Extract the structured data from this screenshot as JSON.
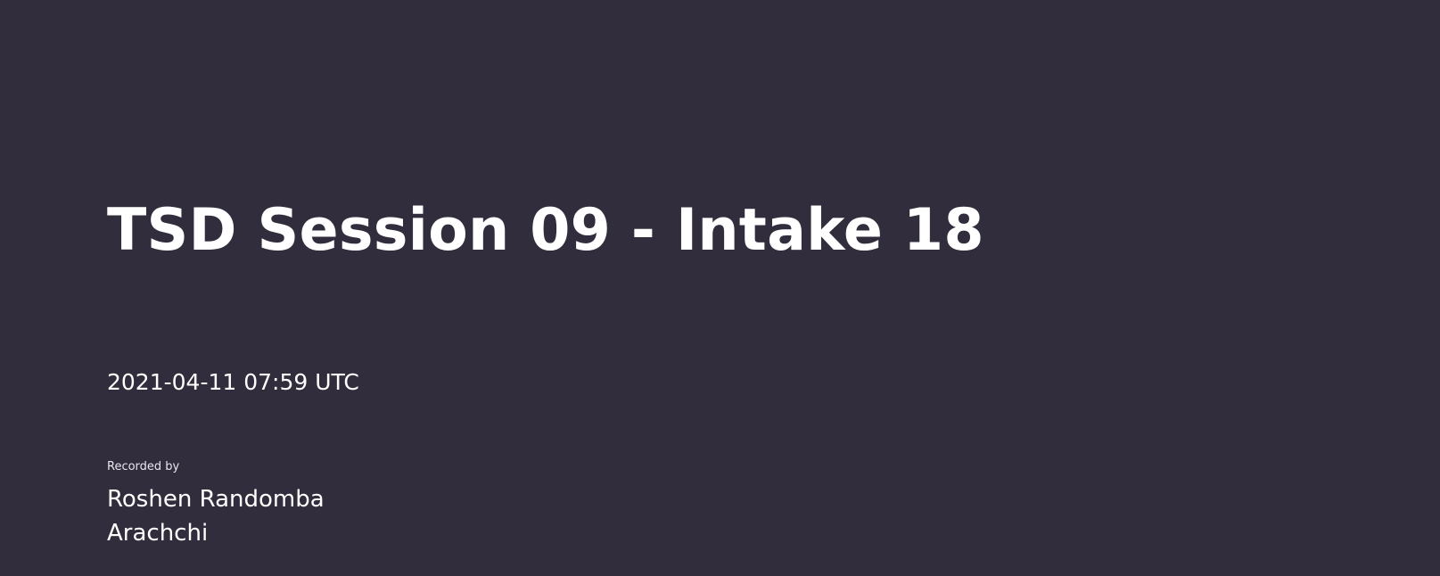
{
  "session": {
    "title": "TSD Session 09 - Intake 18",
    "timestamp": "2021-04-11 07:59 UTC",
    "recorded_by_label": "Recorded by",
    "recorder_name_line1": "Roshen Randomba",
    "recorder_name_line2": "Arachchi"
  },
  "colors": {
    "background": "#322d3c",
    "text": "#ffffff"
  }
}
